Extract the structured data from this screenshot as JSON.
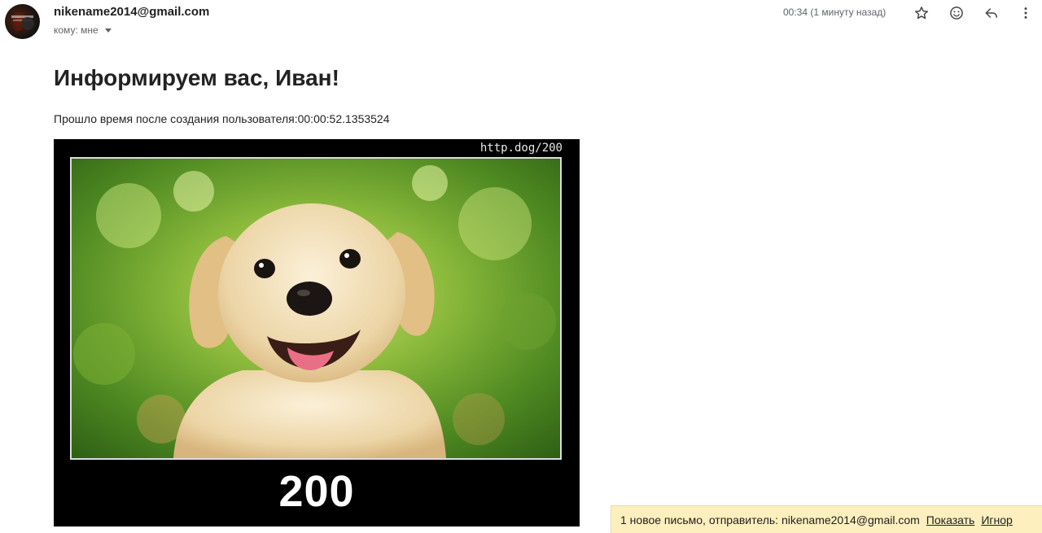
{
  "email": {
    "sender": "nikename2014@gmail.com",
    "recipient_label": "кому: мне",
    "timestamp": "00:34 (1 минуту назад)",
    "title": "Информируем вас, Иван!",
    "body_text": "Прошло время после создания пользователя:00:00:52.1353524"
  },
  "toolbar": {
    "icons": [
      "star-icon",
      "emoji-icon",
      "reply-icon",
      "more-icon"
    ]
  },
  "image_card": {
    "url_text": "http.dog/200",
    "code_text": "200"
  },
  "notification": {
    "text": "1 новое письмо, отправитель: nikename2014@gmail.com",
    "show_link": "Показать",
    "ignore_link": "Игнор"
  },
  "colors": {
    "notification_bg": "#fdefbe",
    "card_bg": "#000000"
  }
}
